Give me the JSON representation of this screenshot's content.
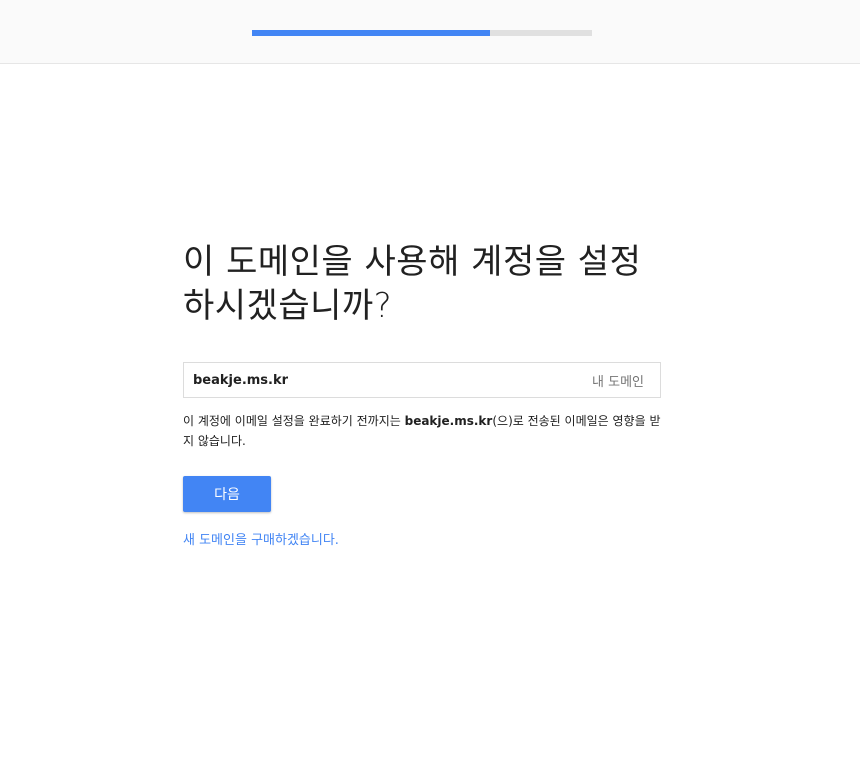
{
  "progress": {
    "percent": 70,
    "fill_color": "#4285f4",
    "track_color": "#e0e0e0"
  },
  "main": {
    "title_line1": "이 도메인을 사용해 계정을 설정",
    "title_line2": "하시겠습니까?",
    "domain_value": "beakje.ms.kr",
    "domain_tag": "내 도메인",
    "description_before": "이 계정에 이메일 설정을 완료하기 전까지는 ",
    "description_domain": "beakje.ms.kr",
    "description_after": "(으)로 전송된 이메일은 영향을 받지 않습니다.",
    "next_button": "다음",
    "buy_link": "새 도메인을 구매하겠습니다."
  }
}
